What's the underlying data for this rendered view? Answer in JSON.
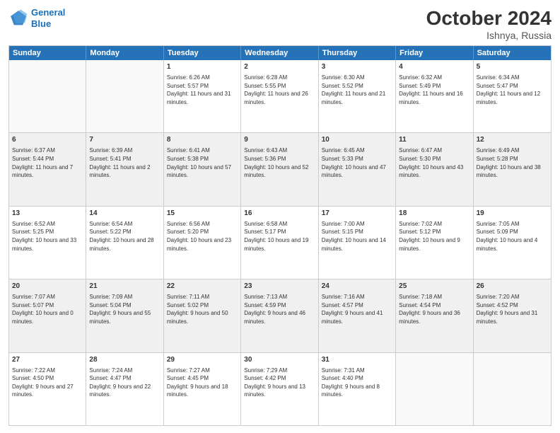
{
  "header": {
    "logo_line1": "General",
    "logo_line2": "Blue",
    "month_year": "October 2024",
    "location": "Ishnya, Russia"
  },
  "days_of_week": [
    "Sunday",
    "Monday",
    "Tuesday",
    "Wednesday",
    "Thursday",
    "Friday",
    "Saturday"
  ],
  "weeks": [
    [
      {
        "day": "",
        "empty": true
      },
      {
        "day": "",
        "empty": true
      },
      {
        "day": "1",
        "sunrise": "6:26 AM",
        "sunset": "5:57 PM",
        "daylight": "11 hours and 31 minutes."
      },
      {
        "day": "2",
        "sunrise": "6:28 AM",
        "sunset": "5:55 PM",
        "daylight": "11 hours and 26 minutes."
      },
      {
        "day": "3",
        "sunrise": "6:30 AM",
        "sunset": "5:52 PM",
        "daylight": "11 hours and 21 minutes."
      },
      {
        "day": "4",
        "sunrise": "6:32 AM",
        "sunset": "5:49 PM",
        "daylight": "11 hours and 16 minutes."
      },
      {
        "day": "5",
        "sunrise": "6:34 AM",
        "sunset": "5:47 PM",
        "daylight": "11 hours and 12 minutes."
      }
    ],
    [
      {
        "day": "6",
        "sunrise": "6:37 AM",
        "sunset": "5:44 PM",
        "daylight": "11 hours and 7 minutes."
      },
      {
        "day": "7",
        "sunrise": "6:39 AM",
        "sunset": "5:41 PM",
        "daylight": "11 hours and 2 minutes."
      },
      {
        "day": "8",
        "sunrise": "6:41 AM",
        "sunset": "5:38 PM",
        "daylight": "10 hours and 57 minutes."
      },
      {
        "day": "9",
        "sunrise": "6:43 AM",
        "sunset": "5:36 PM",
        "daylight": "10 hours and 52 minutes."
      },
      {
        "day": "10",
        "sunrise": "6:45 AM",
        "sunset": "5:33 PM",
        "daylight": "10 hours and 47 minutes."
      },
      {
        "day": "11",
        "sunrise": "6:47 AM",
        "sunset": "5:30 PM",
        "daylight": "10 hours and 43 minutes."
      },
      {
        "day": "12",
        "sunrise": "6:49 AM",
        "sunset": "5:28 PM",
        "daylight": "10 hours and 38 minutes."
      }
    ],
    [
      {
        "day": "13",
        "sunrise": "6:52 AM",
        "sunset": "5:25 PM",
        "daylight": "10 hours and 33 minutes."
      },
      {
        "day": "14",
        "sunrise": "6:54 AM",
        "sunset": "5:22 PM",
        "daylight": "10 hours and 28 minutes."
      },
      {
        "day": "15",
        "sunrise": "6:56 AM",
        "sunset": "5:20 PM",
        "daylight": "10 hours and 23 minutes."
      },
      {
        "day": "16",
        "sunrise": "6:58 AM",
        "sunset": "5:17 PM",
        "daylight": "10 hours and 19 minutes."
      },
      {
        "day": "17",
        "sunrise": "7:00 AM",
        "sunset": "5:15 PM",
        "daylight": "10 hours and 14 minutes."
      },
      {
        "day": "18",
        "sunrise": "7:02 AM",
        "sunset": "5:12 PM",
        "daylight": "10 hours and 9 minutes."
      },
      {
        "day": "19",
        "sunrise": "7:05 AM",
        "sunset": "5:09 PM",
        "daylight": "10 hours and 4 minutes."
      }
    ],
    [
      {
        "day": "20",
        "sunrise": "7:07 AM",
        "sunset": "5:07 PM",
        "daylight": "10 hours and 0 minutes."
      },
      {
        "day": "21",
        "sunrise": "7:09 AM",
        "sunset": "5:04 PM",
        "daylight": "9 hours and 55 minutes."
      },
      {
        "day": "22",
        "sunrise": "7:11 AM",
        "sunset": "5:02 PM",
        "daylight": "9 hours and 50 minutes."
      },
      {
        "day": "23",
        "sunrise": "7:13 AM",
        "sunset": "4:59 PM",
        "daylight": "9 hours and 46 minutes."
      },
      {
        "day": "24",
        "sunrise": "7:16 AM",
        "sunset": "4:57 PM",
        "daylight": "9 hours and 41 minutes."
      },
      {
        "day": "25",
        "sunrise": "7:18 AM",
        "sunset": "4:54 PM",
        "daylight": "9 hours and 36 minutes."
      },
      {
        "day": "26",
        "sunrise": "7:20 AM",
        "sunset": "4:52 PM",
        "daylight": "9 hours and 31 minutes."
      }
    ],
    [
      {
        "day": "27",
        "sunrise": "7:22 AM",
        "sunset": "4:50 PM",
        "daylight": "9 hours and 27 minutes."
      },
      {
        "day": "28",
        "sunrise": "7:24 AM",
        "sunset": "4:47 PM",
        "daylight": "9 hours and 22 minutes."
      },
      {
        "day": "29",
        "sunrise": "7:27 AM",
        "sunset": "4:45 PM",
        "daylight": "9 hours and 18 minutes."
      },
      {
        "day": "30",
        "sunrise": "7:29 AM",
        "sunset": "4:42 PM",
        "daylight": "9 hours and 13 minutes."
      },
      {
        "day": "31",
        "sunrise": "7:31 AM",
        "sunset": "4:40 PM",
        "daylight": "9 hours and 8 minutes."
      },
      {
        "day": "",
        "empty": true
      },
      {
        "day": "",
        "empty": true
      }
    ]
  ]
}
